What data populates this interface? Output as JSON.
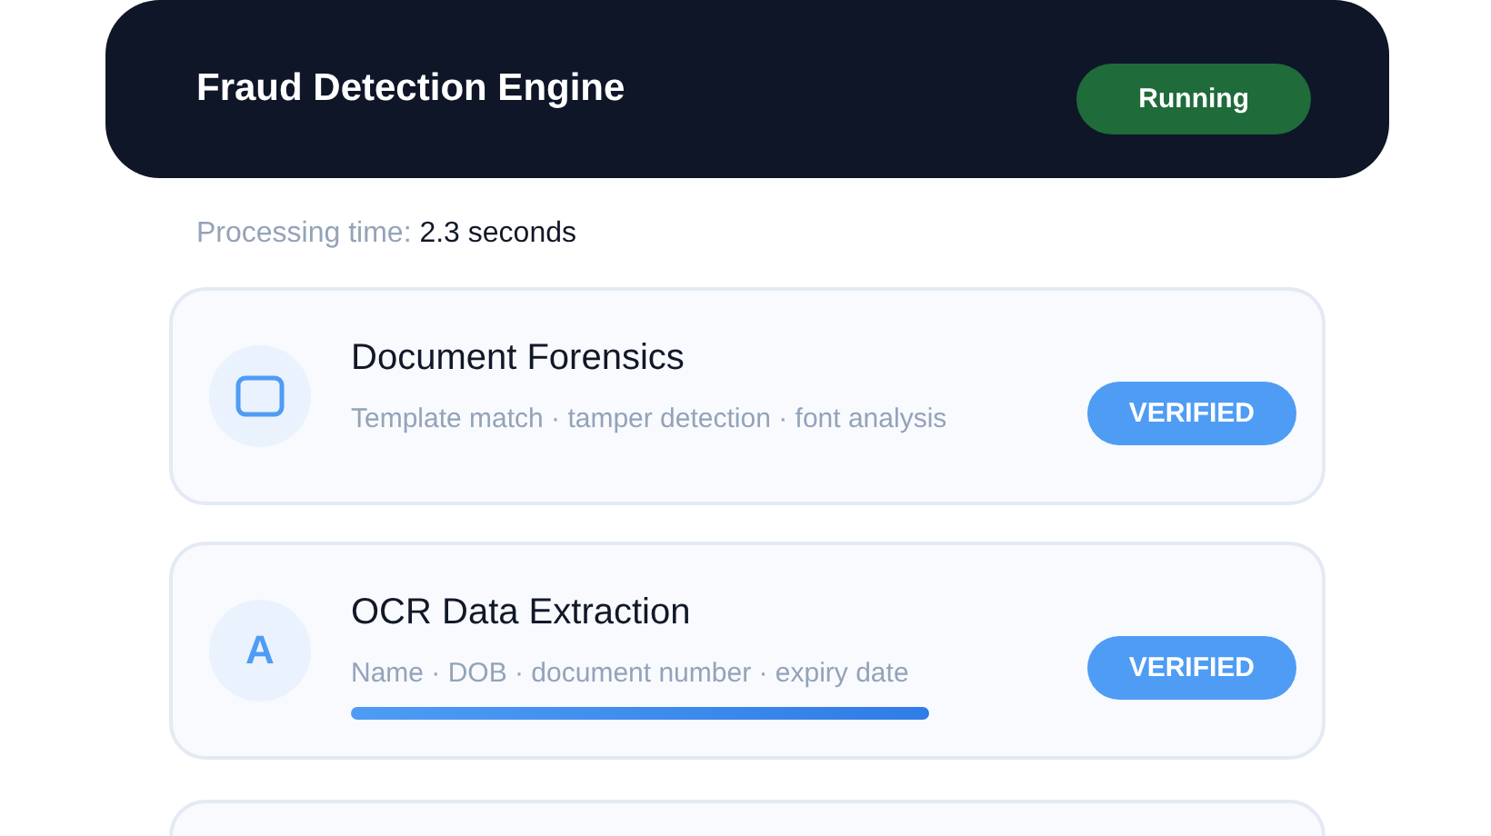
{
  "header": {
    "title": "Fraud Detection Engine",
    "status": {
      "label": "Running",
      "kind": "running"
    }
  },
  "processing": {
    "label": "Processing time:",
    "value": "2.3 seconds"
  },
  "checks": [
    {
      "title": "Document Forensics",
      "details": "Template match · tamper detection · font analysis",
      "icon": {
        "kind": "frame"
      },
      "badge": "VERIFIED"
    },
    {
      "title": "OCR Data Extraction",
      "details": "Name · DOB · document number · expiry date",
      "icon": {
        "kind": "letter",
        "text": "A"
      },
      "badge": "VERIFIED",
      "progress": true
    },
    {
      "kind": "cut"
    }
  ]
}
